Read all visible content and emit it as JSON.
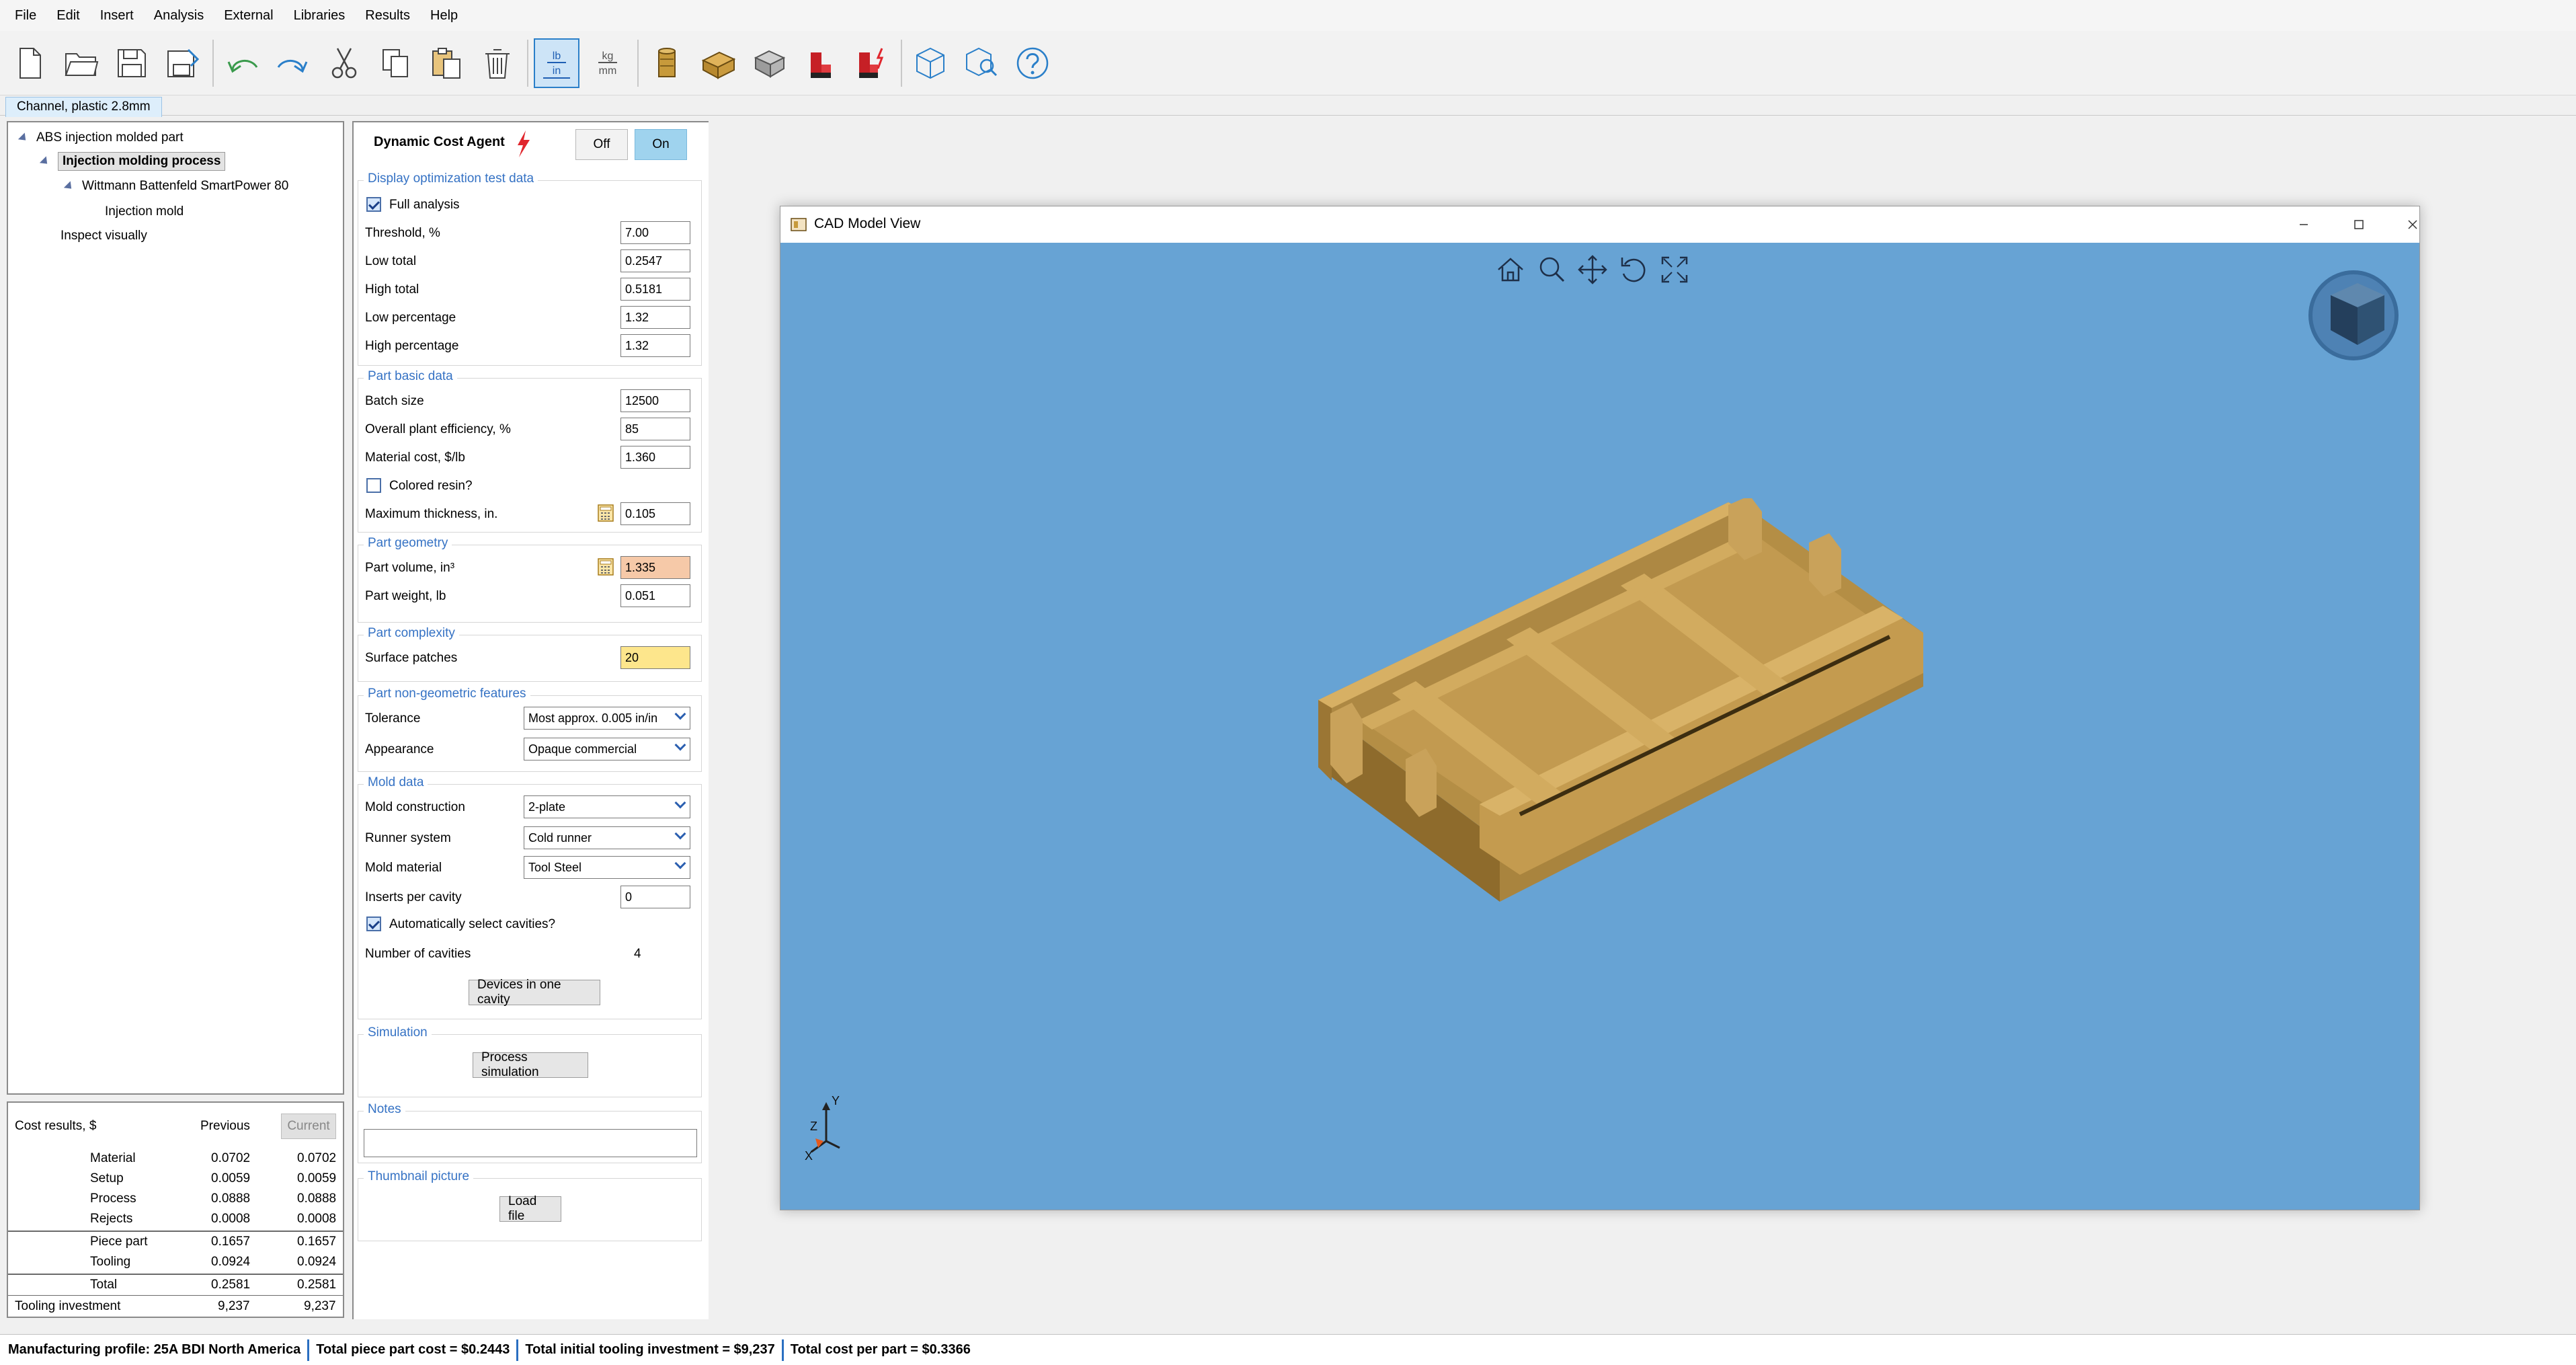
{
  "menu": [
    "File",
    "Edit",
    "Insert",
    "Analysis",
    "External",
    "Libraries",
    "Results",
    "Help"
  ],
  "toolbar": {
    "units_lb": "lb",
    "units_in": "in",
    "units_kg": "kg",
    "units_mm": "mm"
  },
  "document_tab": "Channel, plastic 2.8mm",
  "tree": {
    "root": "ABS injection molded part",
    "process": "Injection molding process",
    "machine": "Wittmann Battenfeld SmartPower 80",
    "mold": "Injection mold",
    "inspect": "Inspect visually"
  },
  "cost_results": {
    "title": "Cost results, $",
    "col_previous": "Previous",
    "col_current": "Current",
    "rows": [
      {
        "label": "Material",
        "previous": "0.0702",
        "current": "0.0702"
      },
      {
        "label": "Setup",
        "previous": "0.0059",
        "current": "0.0059"
      },
      {
        "label": "Process",
        "previous": "0.0888",
        "current": "0.0888"
      },
      {
        "label": "Rejects",
        "previous": "0.0008",
        "current": "0.0008"
      },
      {
        "label": "Piece part",
        "previous": "0.1657",
        "current": "0.1657"
      },
      {
        "label": "Tooling",
        "previous": "0.0924",
        "current": "0.0924"
      },
      {
        "label": "Total",
        "previous": "0.2581",
        "current": "0.2581"
      }
    ],
    "investment_label": "Tooling investment",
    "investment_previous": "9,237",
    "investment_current": "9,237"
  },
  "agent": {
    "title": "Dynamic Cost Agent",
    "off": "Off",
    "on": "On"
  },
  "display_opt": {
    "title": "Display optimization test data",
    "full_analysis": "Full analysis",
    "threshold_label": "Threshold, %",
    "threshold": "7.00",
    "low_total_label": "Low total",
    "low_total": "0.2547",
    "high_total_label": "High total",
    "high_total": "0.5181",
    "low_pct_label": "Low percentage",
    "low_pct": "1.32",
    "high_pct_label": "High percentage",
    "high_pct": "1.32"
  },
  "basic": {
    "title": "Part basic data",
    "batch_label": "Batch size",
    "batch": "12500",
    "eff_label": "Overall plant efficiency, %",
    "eff": "85",
    "matcost_label": "Material cost, $/lb",
    "matcost": "1.360",
    "colored_label": "Colored resin?",
    "maxthick_label": "Maximum thickness, in.",
    "maxthick": "0.105"
  },
  "geometry": {
    "title": "Part geometry",
    "volume_label": "Part volume, in³",
    "volume": "1.335",
    "weight_label": "Part weight, lb",
    "weight": "0.051"
  },
  "complexity": {
    "title": "Part complexity",
    "patches_label": "Surface patches",
    "patches": "20"
  },
  "nongeo": {
    "title": "Part non-geometric features",
    "tolerance_label": "Tolerance",
    "tolerance": "Most approx. 0.005 in/in",
    "appearance_label": "Appearance",
    "appearance": "Opaque commercial"
  },
  "mold": {
    "title": "Mold data",
    "construction_label": "Mold construction",
    "construction": "2-plate",
    "runner_label": "Runner system",
    "runner": "Cold runner",
    "material_label": "Mold material",
    "material": "Tool Steel",
    "inserts_label": "Inserts per cavity",
    "inserts": "0",
    "auto_label": "Automatically select cavities?",
    "cavities_label": "Number of cavities",
    "cavities": "4",
    "devices_btn": "Devices in one cavity"
  },
  "simulation": {
    "title": "Simulation",
    "button": "Process simulation"
  },
  "notes": {
    "title": "Notes",
    "value": ""
  },
  "thumbnail": {
    "title": "Thumbnail picture",
    "button": "Load file"
  },
  "cad": {
    "title": "CAD Model View",
    "axis_y": "Y",
    "axis_z": "Z",
    "axis_x": "X",
    "part_color": "#c9a25a",
    "background": "#67a3d4"
  },
  "status": {
    "profile": "Manufacturing profile: 25A BDI North America",
    "piece_cost": "Total piece part cost = $0.2443",
    "tooling": "Total initial tooling investment = $9,237",
    "cost_per_part": "Total cost per part = $0.3366"
  }
}
